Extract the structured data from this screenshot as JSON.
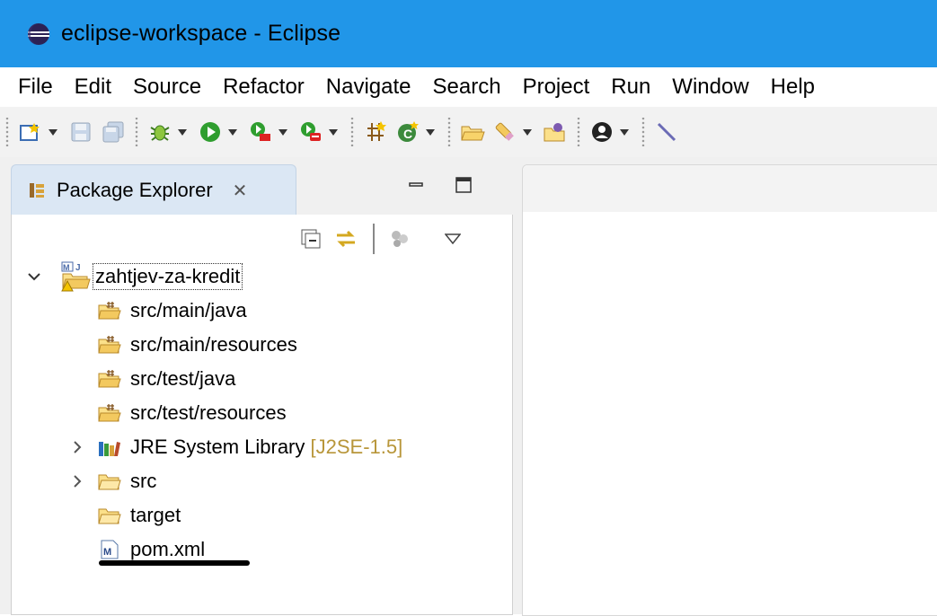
{
  "window": {
    "title": "eclipse-workspace - Eclipse",
    "titlebar_color": "#2196e8"
  },
  "menu": {
    "items": [
      "File",
      "Edit",
      "Source",
      "Refactor",
      "Navigate",
      "Search",
      "Project",
      "Run",
      "Window",
      "Help"
    ]
  },
  "toolbar": {
    "icons": [
      "new-wizard-icon",
      "save-icon",
      "save-all-icon",
      "debug-icon",
      "run-icon",
      "run-last-tool-icon",
      "external-tools-icon",
      "open-type-icon",
      "new-class-icon",
      "open-task-icon",
      "search-icon",
      "open-perspective-icon",
      "user-icon",
      "pin-icon"
    ]
  },
  "package_explorer": {
    "tab_label": "Package Explorer",
    "tab_close_glyph": "✕",
    "tree": {
      "project": "zahtjev-za-kredit",
      "items": [
        {
          "label": "src/main/java",
          "icon": "source-folder-icon"
        },
        {
          "label": "src/main/resources",
          "icon": "source-folder-icon"
        },
        {
          "label": "src/test/java",
          "icon": "source-folder-icon"
        },
        {
          "label": "src/test/resources",
          "icon": "source-folder-icon"
        },
        {
          "label": "JRE System Library",
          "decoration": " [J2SE-1.5]",
          "icon": "library-icon",
          "expandable": true
        },
        {
          "label": "src",
          "icon": "folder-icon",
          "expandable": true
        },
        {
          "label": "target",
          "icon": "folder-icon",
          "expandable": false
        },
        {
          "label": "pom.xml",
          "icon": "maven-file-icon",
          "expandable": false
        }
      ]
    }
  },
  "colors": {
    "decoration": "#b8963a",
    "tab_active": "#dbe7f4"
  }
}
